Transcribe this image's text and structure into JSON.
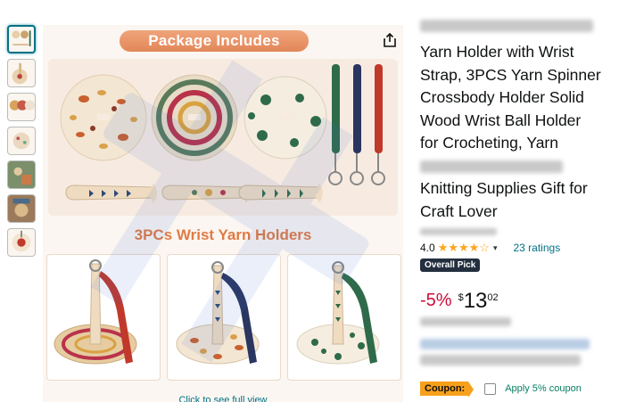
{
  "product": {
    "title_lines": [
      "Yarn Holder with Wrist",
      "Strap, 3PCS Yarn Spinner",
      "Crossbody Holder Solid",
      "Wood Wrist Ball Holder",
      "for Crocheting, Yarn",
      "Knitting Supplies Gift for",
      "Craft Lover"
    ],
    "rating_value": "4.0",
    "stars": "★★★★☆",
    "ratings_text": "23 ratings",
    "badge": "Overall Pick",
    "discount": "-5%",
    "currency": "$",
    "price_whole": "13",
    "price_fraction": "02",
    "coupon_label": "Coupon:",
    "coupon_text": "Apply 5% coupon"
  },
  "gallery": {
    "banner": "Package Includes",
    "section_title": "3PCs Wrist Yarn Holders",
    "click_hint": "Click to see full view",
    "thumbnail_count": 7
  },
  "colors": {
    "accent_orange": "#e07b45",
    "link": "#007185",
    "price_red": "#cc0c39",
    "coupon_green": "#067D62",
    "star": "#ffa41c"
  }
}
